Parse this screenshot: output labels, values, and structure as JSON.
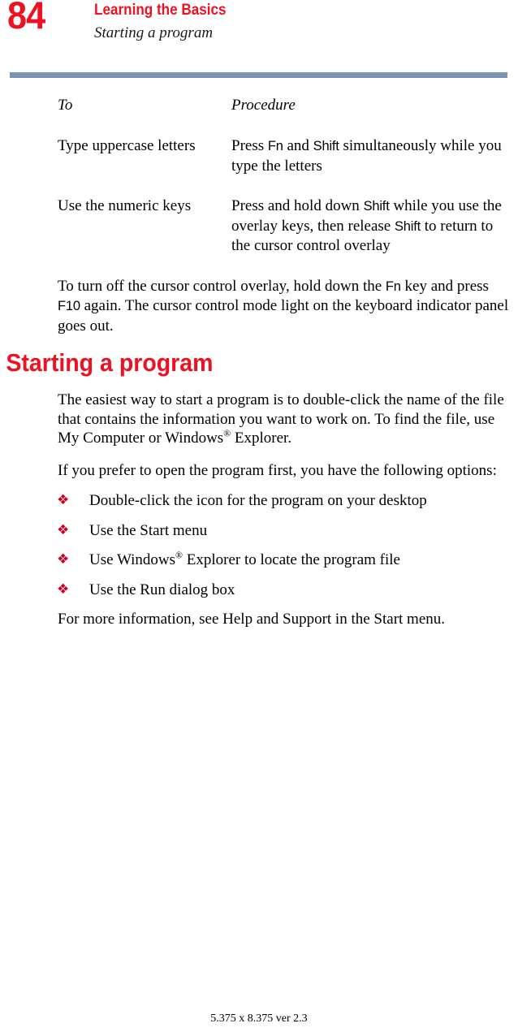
{
  "header": {
    "page_number": "84",
    "title": "Learning the Basics",
    "subtitle": "Starting a program",
    "title_color": "#ee1122",
    "rule_color": "#7b93b0"
  },
  "table": {
    "columns": [
      "To",
      "Procedure"
    ],
    "rows": [
      {
        "to": "Type uppercase letters",
        "procedure_parts": [
          {
            "text": "Press ",
            "style": "normal"
          },
          {
            "text": "Fn",
            "style": "key"
          },
          {
            "text": " and ",
            "style": "normal"
          },
          {
            "text": "Shift",
            "style": "key"
          },
          {
            "text": " simultaneously while you type the letters",
            "style": "normal"
          }
        ]
      },
      {
        "to": "Use the numeric keys",
        "procedure_parts": [
          {
            "text": "Press and hold down ",
            "style": "normal"
          },
          {
            "text": "Shift",
            "style": "key"
          },
          {
            "text": " while you use the overlay keys, then release ",
            "style": "normal"
          },
          {
            "text": "Shift",
            "style": "key"
          },
          {
            "text": " to return to the cursor control overlay",
            "style": "normal"
          }
        ]
      }
    ]
  },
  "paragraphs": {
    "turn_off_overlay_parts": [
      {
        "text": "To turn off the cursor control overlay, hold down the ",
        "style": "normal"
      },
      {
        "text": "Fn",
        "style": "key"
      },
      {
        "text": " key and press ",
        "style": "normal"
      },
      {
        "text": "F10",
        "style": "key"
      },
      {
        "text": " again. The cursor control mode light on the keyboard indicator panel goes out.",
        "style": "normal"
      }
    ],
    "easiest_way_parts": [
      {
        "text": "The easiest way to start a program is to double-click the name of the file that contains the information you want to work on. To find the file, use My Computer or Windows",
        "style": "normal"
      },
      {
        "text": "®",
        "style": "sup"
      },
      {
        "text": " Explorer.",
        "style": "normal"
      }
    ],
    "prefer_open_parts": [
      {
        "text": "If you prefer to open the program first, you have the following options:",
        "style": "normal"
      }
    ],
    "more_information_parts": [
      {
        "text": "For more information, see Help and Support in the Start menu.",
        "style": "normal"
      }
    ]
  },
  "section": {
    "heading": "Starting a program"
  },
  "bullets": {
    "glyph": "❖",
    "glyph_name": "red-diamond-bullet",
    "glyph_color": "#cc0022",
    "items": [
      {
        "parts": [
          {
            "text": "Double-click the icon for the program on your desktop",
            "style": "normal"
          }
        ]
      },
      {
        "parts": [
          {
            "text": "Use the Start menu",
            "style": "normal"
          }
        ]
      },
      {
        "parts": [
          {
            "text": "Use Windows",
            "style": "normal"
          },
          {
            "text": "®",
            "style": "sup"
          },
          {
            "text": " Explorer to locate the program file",
            "style": "normal"
          }
        ]
      },
      {
        "parts": [
          {
            "text": "Use the Run dialog box",
            "style": "normal"
          }
        ]
      }
    ]
  },
  "footer": {
    "text": "5.375 x 8.375 ver 2.3"
  }
}
